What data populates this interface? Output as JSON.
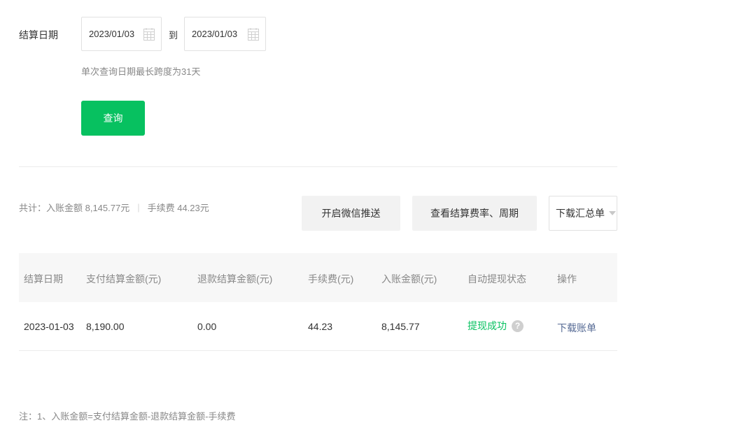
{
  "filter": {
    "date_label": "结算日期",
    "start_date": "2023/01/03",
    "to_label": "到",
    "end_date": "2023/01/03",
    "hint": "单次查询日期最长跨度为31天",
    "query_label": "查询",
    "calendar_icon": "calendar-icon"
  },
  "summary": {
    "income_text": "共计：入账金额 8,145.77元",
    "fee_text": "手续费 44.23元"
  },
  "actions": {
    "wechat_push": "开启微信推送",
    "view_rate": "查看结算费率、周期",
    "download_summary": "下载汇总单"
  },
  "table": {
    "headers": [
      "结算日期",
      "支付结算金额(元)",
      "退款结算金额(元)",
      "手续费(元)",
      "入账金额(元)",
      "自动提现状态",
      "操作"
    ],
    "rows": [
      {
        "date": "2023-01-03",
        "pay_amount": "8,190.00",
        "refund_amount": "0.00",
        "fee": "44.23",
        "income": "8,145.77",
        "status": "提现成功",
        "help": "?",
        "action": "下载账单"
      }
    ]
  },
  "note": "注：1、入账金额=支付结算金额-退款结算金额-手续费",
  "colors": {
    "primary_green": "#07c160",
    "link_blue": "#576b95",
    "muted": "#888888"
  }
}
